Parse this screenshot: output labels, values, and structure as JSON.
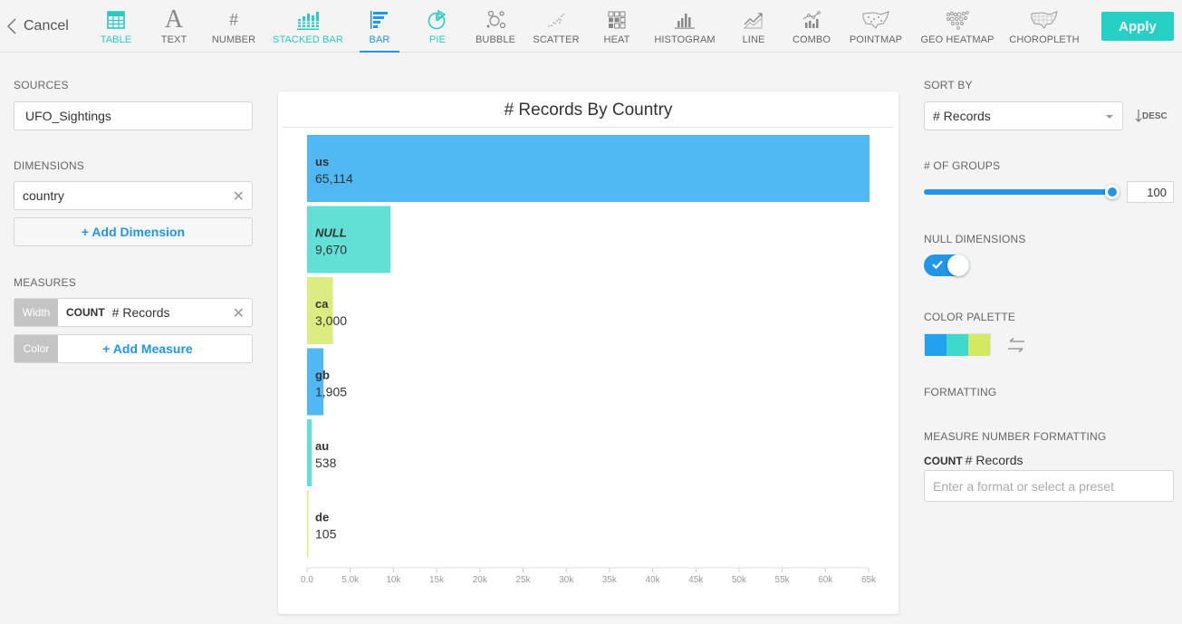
{
  "toolbar": {
    "cancel_label": "Cancel",
    "apply_label": "Apply",
    "chart_types": [
      {
        "label": "TABLE",
        "icon": "table-icon",
        "state": "teal"
      },
      {
        "label": "TEXT",
        "icon": "text-icon",
        "state": "default"
      },
      {
        "label": "NUMBER",
        "icon": "number-icon",
        "state": "default"
      },
      {
        "label": "STACKED BAR",
        "icon": "stacked-bar-icon",
        "state": "teal"
      },
      {
        "label": "BAR",
        "icon": "bar-icon",
        "state": "active"
      },
      {
        "label": "PIE",
        "icon": "pie-icon",
        "state": "teal"
      },
      {
        "label": "BUBBLE",
        "icon": "bubble-icon",
        "state": "default"
      },
      {
        "label": "SCATTER",
        "icon": "scatter-icon",
        "state": "default"
      },
      {
        "label": "HEAT",
        "icon": "heat-icon",
        "state": "default"
      },
      {
        "label": "HISTOGRAM",
        "icon": "histogram-icon",
        "state": "default"
      },
      {
        "label": "LINE",
        "icon": "line-icon",
        "state": "default"
      },
      {
        "label": "COMBO",
        "icon": "combo-icon",
        "state": "default"
      },
      {
        "label": "POINTMAP",
        "icon": "pointmap-icon",
        "state": "default"
      },
      {
        "label": "GEO HEATMAP",
        "icon": "geo-heatmap-icon",
        "state": "default"
      },
      {
        "label": "CHOROPLETH",
        "icon": "choropleth-icon",
        "state": "default"
      }
    ]
  },
  "left_panel": {
    "sources_label": "SOURCES",
    "source_value": "UFO_Sightings",
    "dimensions_label": "DIMENSIONS",
    "dimension_value": "country",
    "add_dimension_label": "+ Add Dimension",
    "measures_label": "MEASURES",
    "measures": [
      {
        "role": "Width",
        "aggregate": "COUNT",
        "field": "# Records"
      },
      {
        "role": "Color",
        "add_label": "+ Add Measure"
      }
    ]
  },
  "right_panel": {
    "sort_by_label": "SORT BY",
    "sort_by_value": "# Records",
    "sort_order": "DESC",
    "groups_label": "# OF GROUPS",
    "groups_value": "100",
    "groups_slider_fraction": 1.0,
    "null_dimensions_label": "NULL DIMENSIONS",
    "null_dimensions_on": true,
    "color_palette_label": "COLOR PALETTE",
    "palette_colors": [
      "#22a2ee",
      "#3ed8cc",
      "#d4e862"
    ],
    "formatting_label": "FORMATTING",
    "measure_number_formatting_label": "MEASURE NUMBER FORMATTING",
    "format_aggregate": "COUNT",
    "format_field": "# Records",
    "format_placeholder": "Enter a format or select a preset"
  },
  "chart_data": {
    "type": "bar",
    "orientation": "horizontal",
    "title": "# Records By Country",
    "xlabel": "",
    "ylabel": "",
    "categories": [
      "us",
      "NULL",
      "ca",
      "gb",
      "au",
      "de"
    ],
    "values": [
      65114,
      9670,
      3000,
      1905,
      538,
      105
    ],
    "value_labels": [
      "65,114",
      "9,670",
      "3,000",
      "1,905",
      "538",
      "105"
    ],
    "bar_colors": [
      "#50b8f2",
      "#62e0d6",
      "#dcec80",
      "#50b8f2",
      "#62e0d6",
      "#dcec80"
    ],
    "xlim": [
      0,
      65000
    ],
    "x_ticks": [
      0,
      5000,
      10000,
      15000,
      20000,
      25000,
      30000,
      35000,
      40000,
      45000,
      50000,
      55000,
      60000,
      65000
    ],
    "x_tick_labels": [
      "0.0",
      "5.0k",
      "10k",
      "15k",
      "20k",
      "25k",
      "30k",
      "35k",
      "40k",
      "45k",
      "50k",
      "55k",
      "60k",
      "65k"
    ],
    "grid": false,
    "legend": "none"
  }
}
